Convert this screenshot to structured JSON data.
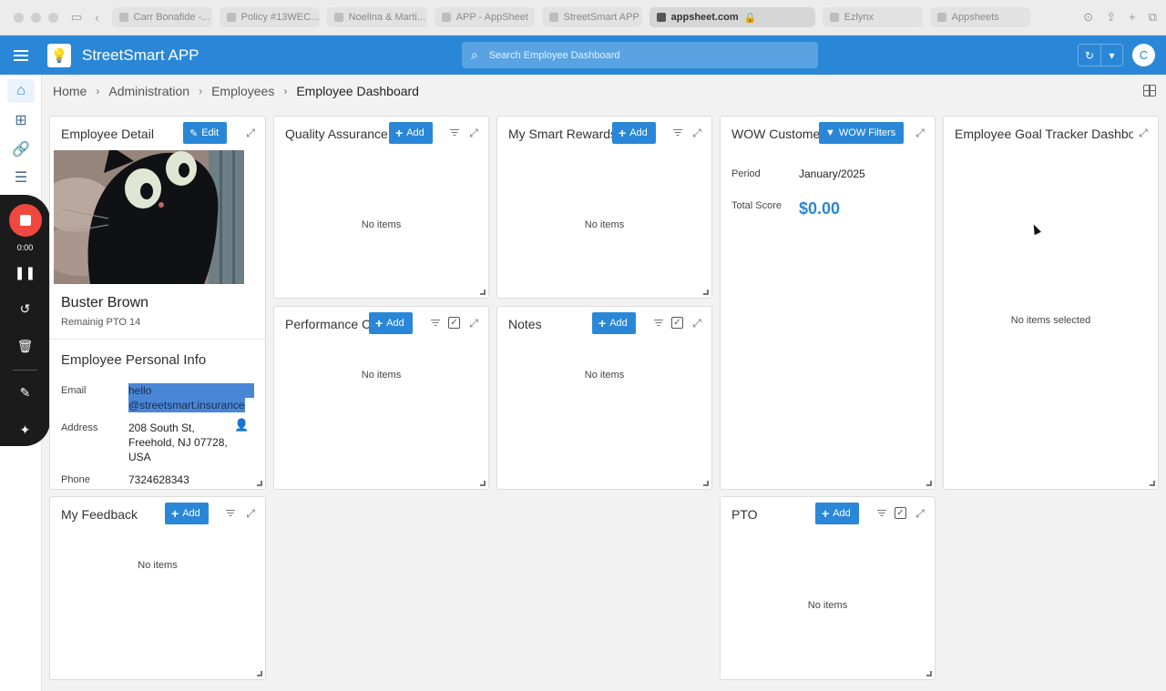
{
  "browser": {
    "tabs": [
      {
        "label": "Carr Bonafide -...",
        "active": false
      },
      {
        "label": "Policy #13WEC...",
        "active": false
      },
      {
        "label": "Noelina & Marti...",
        "active": false
      },
      {
        "label": "APP - AppSheet",
        "active": false
      },
      {
        "label": "StreetSmart APP",
        "active": false
      },
      {
        "label": "appsheet.com",
        "active": true
      },
      {
        "label": "Ezlynx",
        "active": false
      },
      {
        "label": "Appsheets",
        "active": false
      }
    ]
  },
  "app": {
    "title": "StreetSmart APP",
    "search_placeholder": "Search Employee Dashboard",
    "avatar_initial": "C",
    "accent_color": "#2a87d7"
  },
  "recorder": {
    "time": "0:00"
  },
  "breadcrumb": [
    "Home",
    "Administration",
    "Employees",
    "Employee Dashboard"
  ],
  "employee_detail": {
    "title": "Employee Detail",
    "edit_label": "Edit",
    "name": "Buster Brown",
    "pto": "Remainig PTO 14",
    "section_title": "Employee Personal Info",
    "fields": {
      "email_label": "Email",
      "email_line1": "hello",
      "email_line2": "@streetsmart.insurance",
      "address_label": "Address",
      "address_line1": "208 South St,",
      "address_line2": "Freehold, NJ 07728,",
      "address_line3": "USA",
      "phone_label": "Phone",
      "phone_value": "7324628343"
    }
  },
  "panels": {
    "quality": {
      "title": "Quality Assurance",
      "add": "Add",
      "empty": "No items"
    },
    "rewards": {
      "title": "My Smart Rewards",
      "add": "Add",
      "empty": "No items"
    },
    "wow": {
      "title": "WOW Customer",
      "filter": "WOW Filters",
      "period_label": "Period",
      "period_value": "January/2025",
      "score_label": "Total Score",
      "score_value": "$0.00"
    },
    "goal": {
      "title": "Employee Goal Tracker Dashboa",
      "empty": "No items selected"
    },
    "performance": {
      "title": "Performance C",
      "add": "Add",
      "empty": "No items"
    },
    "notes": {
      "title": "Notes",
      "add": "Add",
      "empty": "No items"
    },
    "feedback": {
      "title": "My Feedback",
      "add": "Add",
      "empty": "No items"
    },
    "pto": {
      "title": "PTO",
      "add": "Add",
      "empty": "No items"
    }
  }
}
